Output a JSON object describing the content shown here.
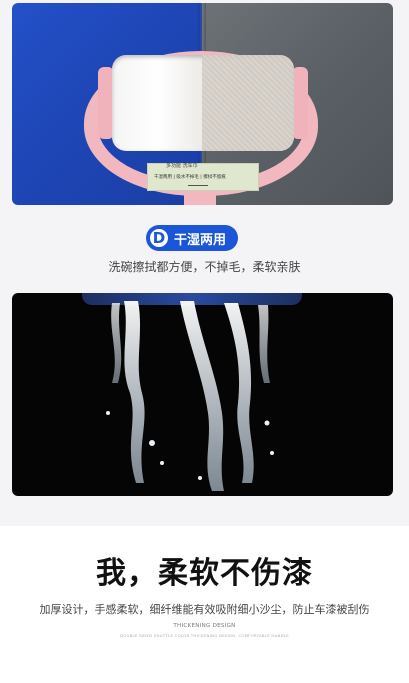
{
  "product_panel": {
    "label_title": "多功能 洗车巾",
    "label_subtitle": "干湿两用 | 吸水不掉毛 | 擦拭不留痕"
  },
  "feature_badge": {
    "letter": "D",
    "title": "干湿两用"
  },
  "feature_caption": "洗碗擦拭都方便，不掉毛，柔软亲肤",
  "headline": "我，柔软不伤漆",
  "description": "加厚设计，手感柔软，细纤维能有效吸附细小沙尘，防止车漆被刮伤",
  "english_title": "THICKENING DESIGN",
  "english_subtitle": "DOUBLE SIDED SHUTTLE COLOR THICKENING DESIGN, COMFORTABLE HANDLE",
  "colors": {
    "accent_blue": "#1b55d8",
    "cloth_blue": "#2351c9",
    "cloth_gray": "#5b6066",
    "handle_pink": "#f2b8c0"
  }
}
